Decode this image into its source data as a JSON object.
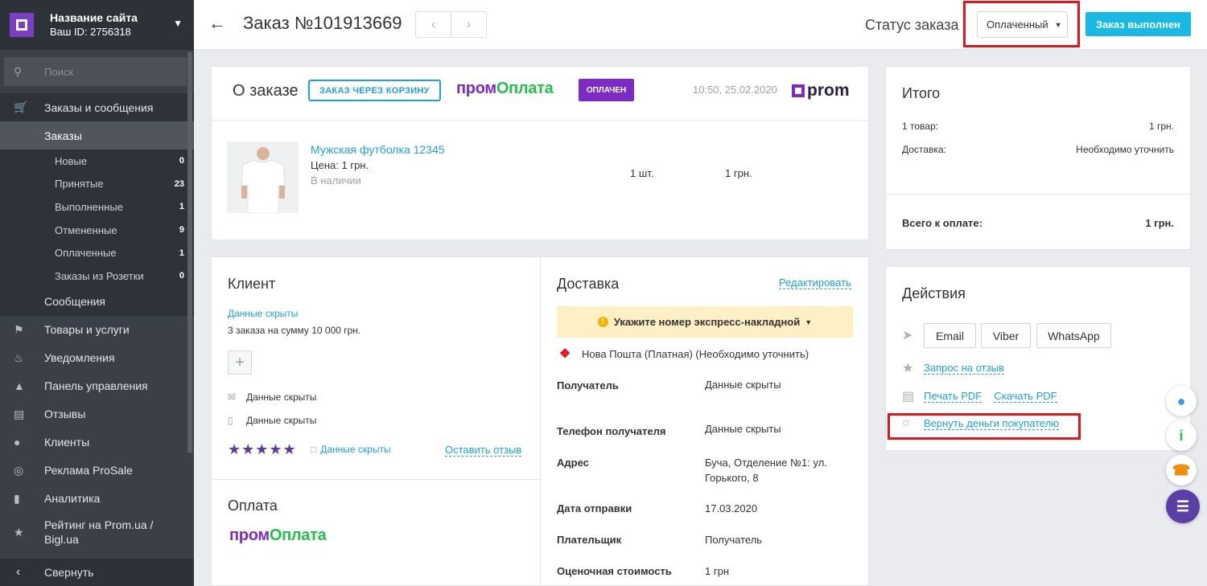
{
  "sidebar": {
    "site_name": "Название сайта",
    "site_id": "Ваш ID: 2756318",
    "search_placeholder": "Поиск",
    "orders_messages": "Заказы и сообщения",
    "orders": "Заказы",
    "sub_items": [
      {
        "label": "Новые",
        "count": "0"
      },
      {
        "label": "Принятые",
        "count": "23"
      },
      {
        "label": "Выполненные",
        "count": "1"
      },
      {
        "label": "Отмененные",
        "count": "9"
      },
      {
        "label": "Оплаченные",
        "count": "1"
      },
      {
        "label": "Заказы из Розетки",
        "count": "0"
      }
    ],
    "messages": "Сообщения",
    "nav": [
      {
        "label": "Товары и услуги",
        "icon": "tag-icon"
      },
      {
        "label": "Уведомления",
        "icon": "bell-icon"
      },
      {
        "label": "Панель управления",
        "icon": "dashboard-icon"
      },
      {
        "label": "Отзывы",
        "icon": "reviews-icon"
      },
      {
        "label": "Клиенты",
        "icon": "clients-icon"
      },
      {
        "label": "Реклама ProSale",
        "icon": "target-icon"
      },
      {
        "label": "Аналитика",
        "icon": "analytics-icon"
      }
    ],
    "rating_line1": "Рейтинг на Prom.ua /",
    "rating_line2": "Bigl.ua",
    "collapse": "Свернуть"
  },
  "topbar": {
    "title": "Заказ №101913669",
    "status_label": "Статус заказа",
    "status_value": "Оплаченный",
    "done_button": "Заказ выполнен"
  },
  "order": {
    "title": "О заказе",
    "cart_tag": "ЗАКАЗ ЧЕРЕЗ КОРЗИНУ",
    "promo_part1": "пром",
    "promo_part2": "Оплата",
    "paid_tag": "ОПЛАЧЕН",
    "datetime": "10:50, 25.02.2020",
    "prom_logo": "prom",
    "product_name": "Мужская футболка 12345",
    "product_price": "Цена: 1 грн.",
    "product_availability": "В наличии",
    "qty": "1 шт.",
    "sum": "1 грн."
  },
  "client": {
    "title": "Клиент",
    "hidden_link": "Данные скрыты",
    "orders_sum": "3 заказа на сумму 10 000 грн.",
    "email": "Данные скрыты",
    "phone": "Данные скрыты",
    "stars": "★★★★★",
    "review_hidden": "Данные скрыты",
    "leave_review": "Оставить отзыв",
    "payment_title": "Оплата"
  },
  "delivery": {
    "title": "Доставка",
    "edit": "Редактировать",
    "warning": "Укажите номер экспресс-накладной",
    "carrier": "Нова Пошта (Платная) (Необходимо уточнить)",
    "rows": [
      {
        "label": "Получатель",
        "value": "Данные скрыты"
      },
      {
        "label": "Телефон получателя",
        "value": "Данные скрыты"
      },
      {
        "label": "Адрес",
        "value": "Буча, Отделение №1: ул. Горького, 8"
      },
      {
        "label": "Дата отправки",
        "value": "17.03.2020"
      },
      {
        "label": "Плательщик",
        "value": "Получатель"
      },
      {
        "label": "Оценочная стоимость",
        "value": "1 грн"
      }
    ]
  },
  "summary": {
    "title": "Итого",
    "items_label": "1 товар:",
    "items_value": "1 грн.",
    "delivery_label": "Доставка:",
    "delivery_value": "Необходимо уточнить",
    "total_label": "Всего к оплате:",
    "total_value": "1 грн."
  },
  "actions": {
    "title": "Действия",
    "email": "Email",
    "viber": "Viber",
    "whatsapp": "WhatsApp",
    "review_request": "Запрос на отзыв",
    "print_pdf": "Печать PDF",
    "download_pdf": "Скачать PDF",
    "refund": "Вернуть деньги покупателю"
  },
  "colors": {
    "accent": "#19b9e6",
    "promo_purple": "#7c2bc4",
    "promo_green": "#21c14a",
    "highlight_red": "#e3151a",
    "sidebar_bg": "#3b4048"
  }
}
